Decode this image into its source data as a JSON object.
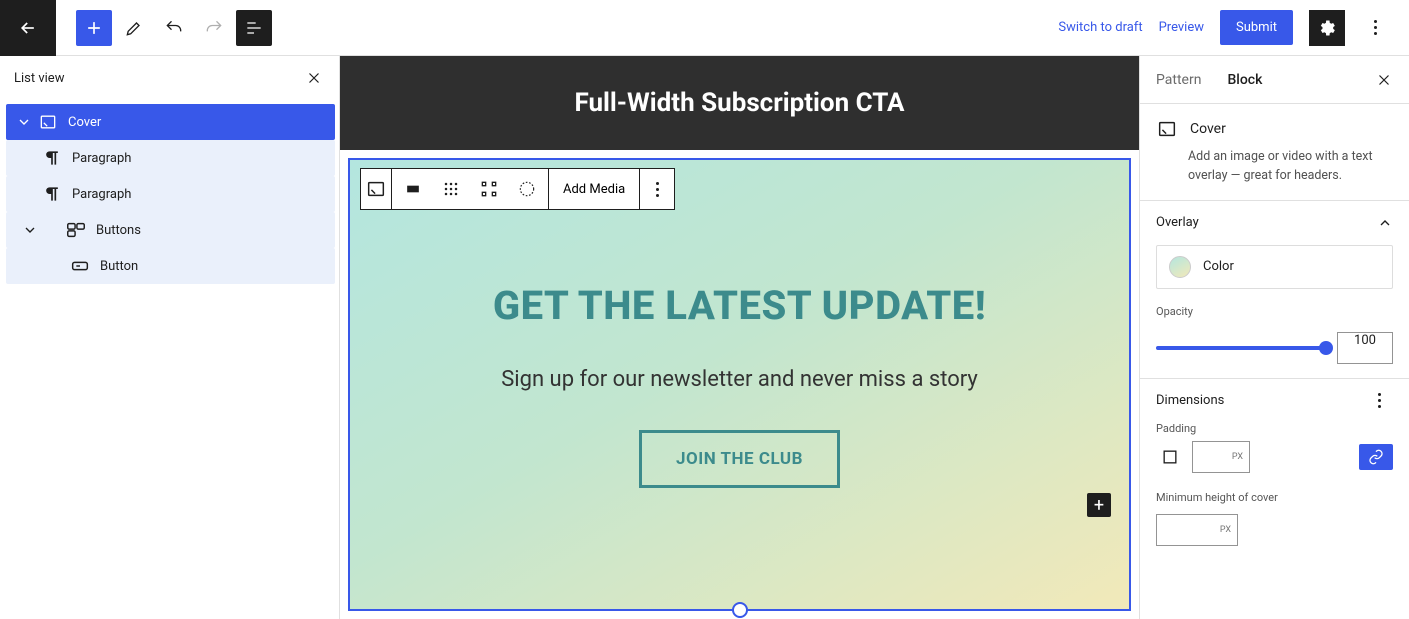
{
  "toolbar": {
    "switch_draft": "Switch to draft",
    "preview": "Preview",
    "submit": "Submit"
  },
  "list_view": {
    "title": "List view",
    "items": [
      {
        "label": "Cover"
      },
      {
        "label": "Paragraph"
      },
      {
        "label": "Paragraph"
      },
      {
        "label": "Buttons"
      },
      {
        "label": "Button"
      }
    ]
  },
  "canvas": {
    "title": "Full-Width Subscription CTA",
    "add_media": "Add Media",
    "headline": "GET THE LATEST UPDATE!",
    "subline": "Sign up for our newsletter and never miss a story",
    "cta": "JOIN THE CLUB"
  },
  "inspector": {
    "tab_pattern": "Pattern",
    "tab_block": "Block",
    "block_name": "Cover",
    "block_desc": "Add an image or video with a text overlay — great for headers.",
    "overlay": "Overlay",
    "color": "Color",
    "opacity_label": "Opacity",
    "opacity_value": "100",
    "dimensions": "Dimensions",
    "padding": "Padding",
    "px": "PX",
    "min_height": "Minimum height of cover"
  }
}
